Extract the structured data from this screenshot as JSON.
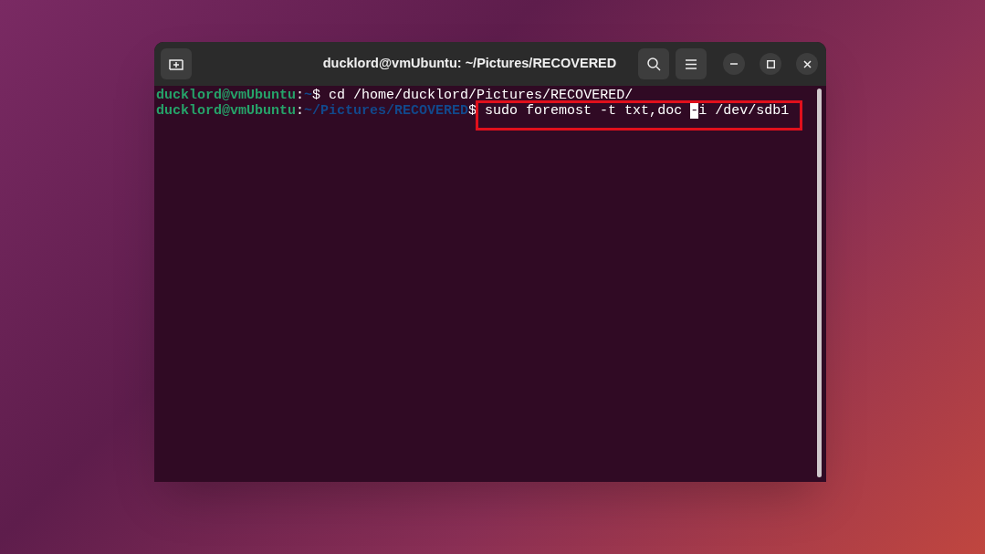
{
  "window": {
    "title": "ducklord@vmUbuntu: ~/Pictures/RECOVERED"
  },
  "terminal": {
    "lines": [
      {
        "user_host": "ducklord@vmUbuntu",
        "separator": ":",
        "path": "~",
        "prompt": "$",
        "command_before": " cd /home/ducklord/Pictures/RECOVERED/",
        "highlighted": false
      },
      {
        "user_host": "ducklord@vmUbuntu",
        "separator": ":",
        "path": "~/Pictures/RECOVERED",
        "prompt": "$",
        "command_before": " sudo foremost -t txt,doc ",
        "cursor_char": "-",
        "command_after": "i /dev/sdb1",
        "highlighted": true
      }
    ]
  }
}
